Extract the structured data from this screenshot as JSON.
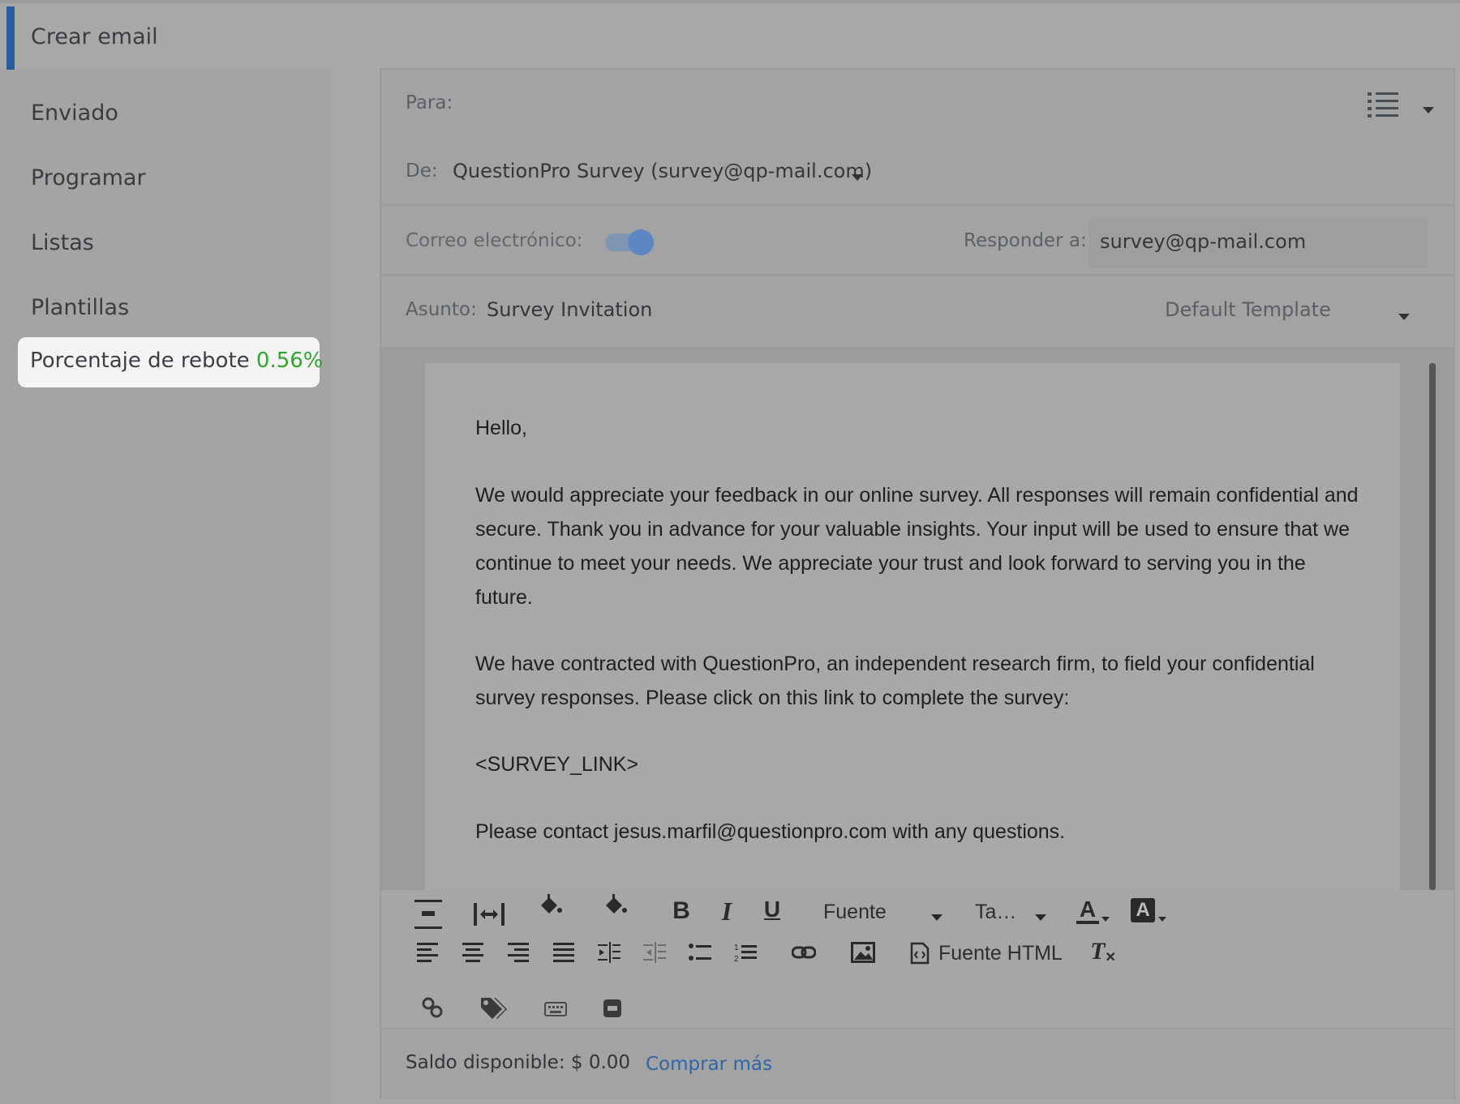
{
  "topbar": {
    "title": "Crear email"
  },
  "sidebar": {
    "items": [
      {
        "label": "Enviado"
      },
      {
        "label": "Programar"
      },
      {
        "label": "Listas"
      },
      {
        "label": "Plantillas"
      }
    ],
    "bounce": {
      "label": "Porcentaje de rebote",
      "value": "0.56%"
    }
  },
  "compose": {
    "to_label": "Para:",
    "from_label": "De:",
    "from_value": "QuestionPro Survey (survey@qp-mail.com)",
    "email_label": "Correo electrónico:",
    "email_toggle_on": true,
    "reply_label": "Responder a:",
    "reply_value": "survey@qp-mail.com",
    "subject_label": "Asunto:",
    "subject_value": "Survey Invitation",
    "template_value": "Default Template"
  },
  "body": {
    "greeting": "Hello,",
    "p1": "We would appreciate your feedback in our online survey. All responses will remain confidential and secure. Thank you in advance for your valuable insights. Your input will be used to ensure that we continue to meet your needs. We appreciate your trust and look forward to serving you in the future.",
    "p2": "We have contracted with QuestionPro, an independent research firm, to field your confidential survey responses. Please click on this link to complete the survey:",
    "link": "<SURVEY_LINK>",
    "contact": "Please contact jesus.marfil@questionpro.com with any questions."
  },
  "toolbar": {
    "font_label": "Fuente",
    "size_label": "Ta…",
    "html_source_label": "Fuente HTML"
  },
  "footer": {
    "balance": "Saldo disponible: $ 0.00",
    "buy_more": "Comprar más"
  },
  "colors": {
    "accent": "#2b5d9c",
    "bounce_value": "#31a32e",
    "link": "#2e66a8",
    "toggle": "#5b88c5"
  }
}
